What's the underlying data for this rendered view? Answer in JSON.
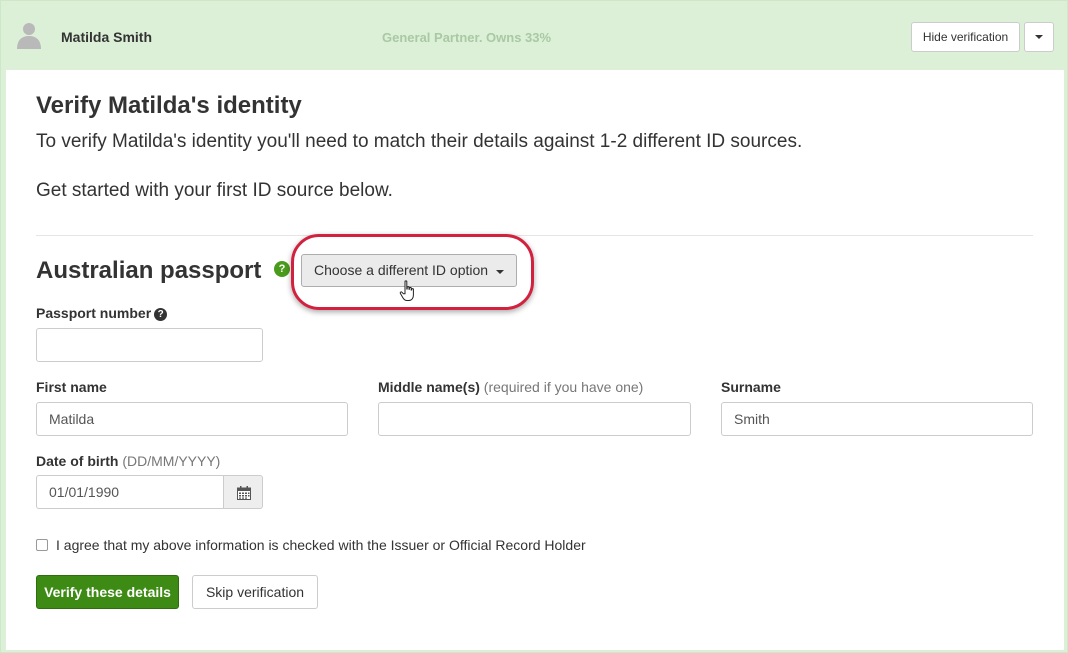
{
  "header": {
    "person_name": "Matilda Smith",
    "role": "General Partner. Owns 33%",
    "hide_button": "Hide verification"
  },
  "panel": {
    "title": "Verify Matilda's identity",
    "intro": "To verify Matilda's identity you'll need to match their details against 1-2 different ID sources.",
    "intro2": "Get started with your first ID source below.",
    "section_title": "Australian passport",
    "id_option_button": "Choose a different ID option"
  },
  "form": {
    "passport_label": "Passport number",
    "passport_value": "",
    "first_name_label": "First name",
    "first_name_value": "Matilda",
    "middle_name_label": "Middle name(s)",
    "middle_name_hint": "(required if you have one)",
    "middle_name_value": "",
    "surname_label": "Surname",
    "surname_value": "Smith",
    "dob_label": "Date of birth",
    "dob_hint": "(DD/MM/YYYY)",
    "dob_value": "01/01/1990",
    "agree_text": "I agree that my above information is checked with the Issuer or Official Record Holder",
    "agree_checked": false
  },
  "actions": {
    "verify_button": "Verify these details",
    "skip_button": "Skip verification"
  },
  "colors": {
    "header_bg": "#dcf0d7",
    "primary_green": "#3d8b14",
    "highlight_red": "#d2213f"
  }
}
